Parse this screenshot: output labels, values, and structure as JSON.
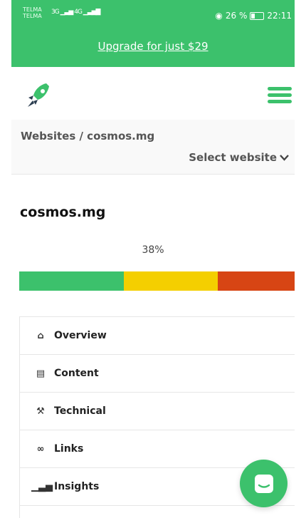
{
  "status_bar": {
    "carrier_top": "TELMA",
    "carrier_bottom": "TELMA",
    "network_3g": "3G",
    "network_4g": "4G",
    "battery_percent": "26 %",
    "time": "22:11"
  },
  "promo": {
    "upgrade_link": "Upgrade for just $29"
  },
  "breadcrumb": {
    "path": "Websites / cosmos.mg",
    "select_label": "Select website"
  },
  "site": {
    "title": "cosmos.mg",
    "score_percent": "38%",
    "score_bar": [
      {
        "fraction": 0.38,
        "color": "#3cc16c"
      },
      {
        "fraction": 0.34,
        "color": "#f4cf00"
      },
      {
        "fraction": 0.28,
        "color": "#d74514"
      }
    ]
  },
  "nav": {
    "items": [
      {
        "label": "Overview",
        "icon": "home-icon"
      },
      {
        "label": "Content",
        "icon": "document-icon"
      },
      {
        "label": "Technical",
        "icon": "wrench-icon"
      },
      {
        "label": "Links",
        "icon": "link-icon"
      },
      {
        "label": "Insights",
        "icon": "signal-icon"
      }
    ]
  },
  "colors": {
    "accent": "#3cc16c",
    "yellow": "#f4cf00",
    "red": "#d74514"
  },
  "chat": {
    "icon": "chat-icon"
  }
}
